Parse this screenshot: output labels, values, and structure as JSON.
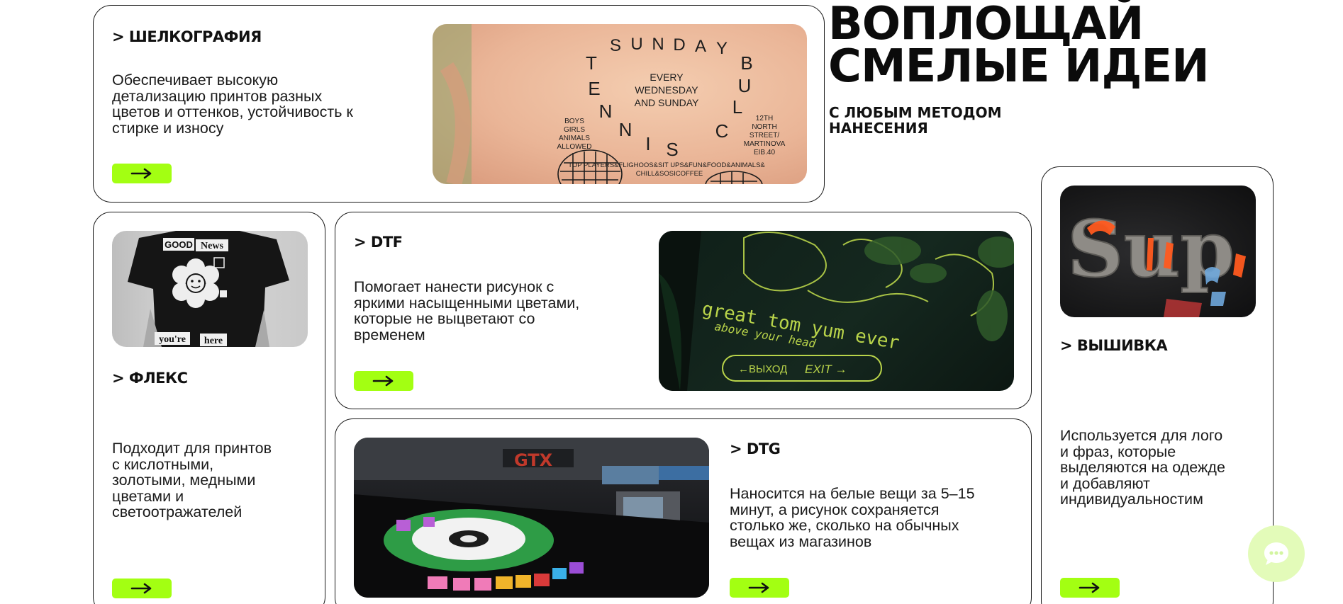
{
  "hero": {
    "headline_line1": "ВОПЛОЩАЙ",
    "headline_line2": "СМЕЛЫЕ ИДЕИ",
    "sub_line1": "С ЛЮБЫМ МЕТОДОМ",
    "sub_line2": "НАНЕСЕНИЯ"
  },
  "cards": {
    "silkscreen": {
      "title": "> ШЕЛКОГРАФИЯ",
      "desc_line1": "Обеспечивает высокую",
      "desc_line2": "детализацию принтов разных",
      "desc_line3": "цветов и оттенков, устойчивость к",
      "desc_line4": "стирке и износу",
      "shirt_text": {
        "arc": [
          "S",
          "U",
          "N",
          "D",
          "A",
          "Y",
          "T",
          "E",
          "N",
          "N",
          "I",
          "S",
          "C",
          "L",
          "U",
          "B"
        ],
        "center1": "EVERY",
        "center2": "WEDNESDAY",
        "center3": "AND SUNDAY",
        "left1": "BOYS",
        "left2": "GIRLS",
        "left3": "ANIMALS",
        "left4": "ALLOWED",
        "right1": "12TH",
        "right2": "NORTH",
        "right3": "STREET/",
        "right4": "MARTINOVA",
        "right5": "EIB.40",
        "bottom1": "TOP PLAYERS&FLIGHOOS&SIT UPS&FUN&FOOD&ANIMALS&",
        "bottom2": "CHILL&SOSICOFFEE"
      }
    },
    "flex": {
      "title": "> ФЛЕКС",
      "desc_line1": "Подходит для принтов",
      "desc_line2": "с кислотными,",
      "desc_line3": "золотыми, медными",
      "desc_line4": "цветами и",
      "desc_line5": "светоотражателей",
      "shirt_text": {
        "top_left": "GOOD",
        "top_right": "News",
        "bottom_left": "you're",
        "bottom_right": "here"
      }
    },
    "dtf": {
      "title": "> DTF",
      "desc_line1": "Помогает нанести рисунок с",
      "desc_line2": "яркими насыщенными цветами,",
      "desc_line3": "которые не выцветают со",
      "desc_line4": "временем",
      "shirt_text": {
        "line1": "great tom yum ever",
        "line2": "above your head",
        "sign_left": "←ВЫХОД",
        "sign_right": "EXIT →"
      }
    },
    "dtg": {
      "title": "> DTG",
      "desc_line1": "Наносится на белые вещи за 5–15",
      "desc_line2": "минут, а рисунок сохраняется",
      "desc_line3": "столько же, сколько на обычных",
      "desc_line4": "вещах из магазинов",
      "machine_text": "GTX"
    },
    "embroidery": {
      "title": "> ВЫШИВКА",
      "desc_line1": "Используется для лого",
      "desc_line2": "и фраз, которые",
      "desc_line3": "выделяются на одежде",
      "desc_line4": "и добавляют",
      "desc_line5": "индивидуальностим",
      "patch_text": "Sup"
    }
  },
  "colors": {
    "accent": "#a3ff12",
    "text": "#111111",
    "border": "#1a1a1a",
    "chat_bubble": "#e3fbb9"
  },
  "icons": {
    "arrow": "arrow-right-icon",
    "chat": "chat-icon"
  }
}
